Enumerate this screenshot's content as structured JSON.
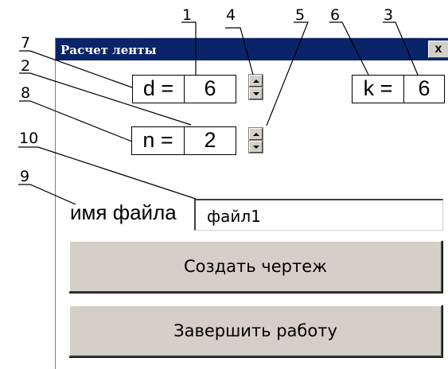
{
  "window": {
    "title": "Расчет ленты",
    "close_label": "x"
  },
  "fields": {
    "d": {
      "label": "d =",
      "value": "6"
    },
    "n": {
      "label": "n =",
      "value": "2"
    },
    "k": {
      "label": "k =",
      "value": "6"
    }
  },
  "file": {
    "label": "имя файла",
    "value": "файл1"
  },
  "buttons": {
    "create": "Создать чертеж",
    "finish": "Завершить работу"
  },
  "callouts": [
    "1",
    "2",
    "3",
    "4",
    "5",
    "6",
    "7",
    "8",
    "9",
    "10"
  ],
  "colors": {
    "titlebar": "#0a246a",
    "button_face": "#d4d0c8"
  }
}
